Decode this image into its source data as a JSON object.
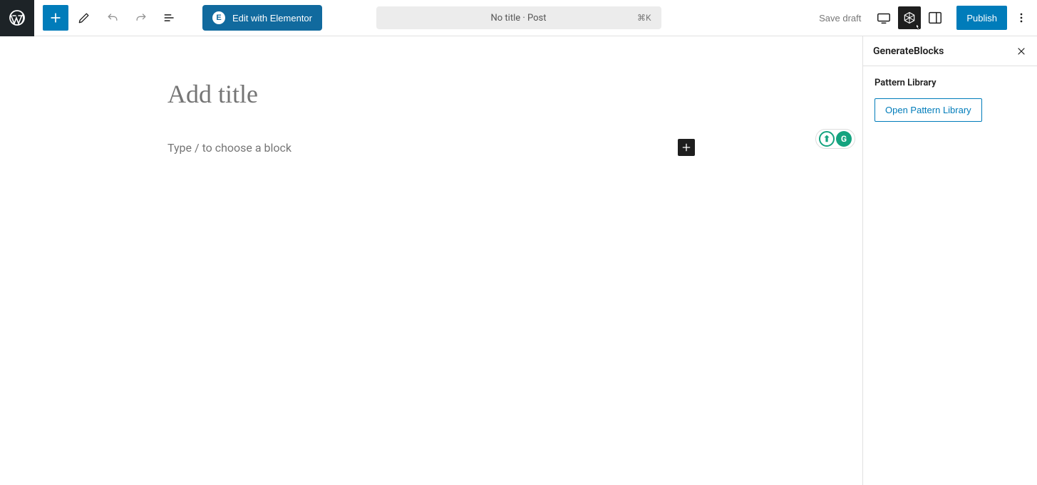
{
  "toolbar": {
    "elementor_label": "Edit with Elementor",
    "doc_title": "No title · Post",
    "doc_shortcut": "⌘K",
    "save_draft": "Save draft",
    "publish": "Publish"
  },
  "editor": {
    "title_placeholder": "Add title",
    "block_placeholder": "Type / to choose a block"
  },
  "sidebar": {
    "panel_title": "GenerateBlocks",
    "section_title": "Pattern Library",
    "open_library_label": "Open Pattern Library"
  },
  "badges": {
    "a_glyph": "⬆",
    "b_glyph": "G"
  }
}
